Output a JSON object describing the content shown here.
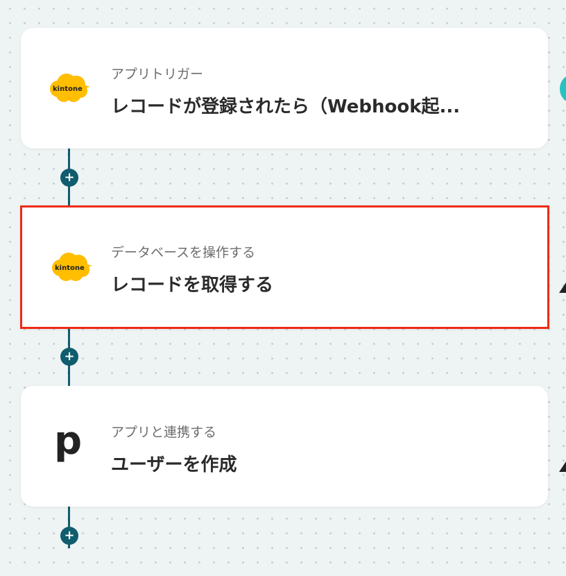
{
  "flow": {
    "steps": [
      {
        "type_label": "アプリトリガー",
        "title": "レコードが登録されたら（Webhook起...",
        "app_icon": "kintone-logo",
        "logo_text": "kintone"
      },
      {
        "type_label": "データベースを操作する",
        "title": "レコードを取得する",
        "app_icon": "kintone-logo",
        "logo_text": "kintone",
        "selected": true
      },
      {
        "type_label": "アプリと連携する",
        "title": "ユーザーを作成",
        "app_icon": "p-logo",
        "logo_text": "p"
      }
    ],
    "add_step_symbol": "+",
    "colors": {
      "connector": "#0f5d6e",
      "highlight": "#ee2a16",
      "kintone": "#ffbe00",
      "accent": "#26c2c2"
    }
  }
}
